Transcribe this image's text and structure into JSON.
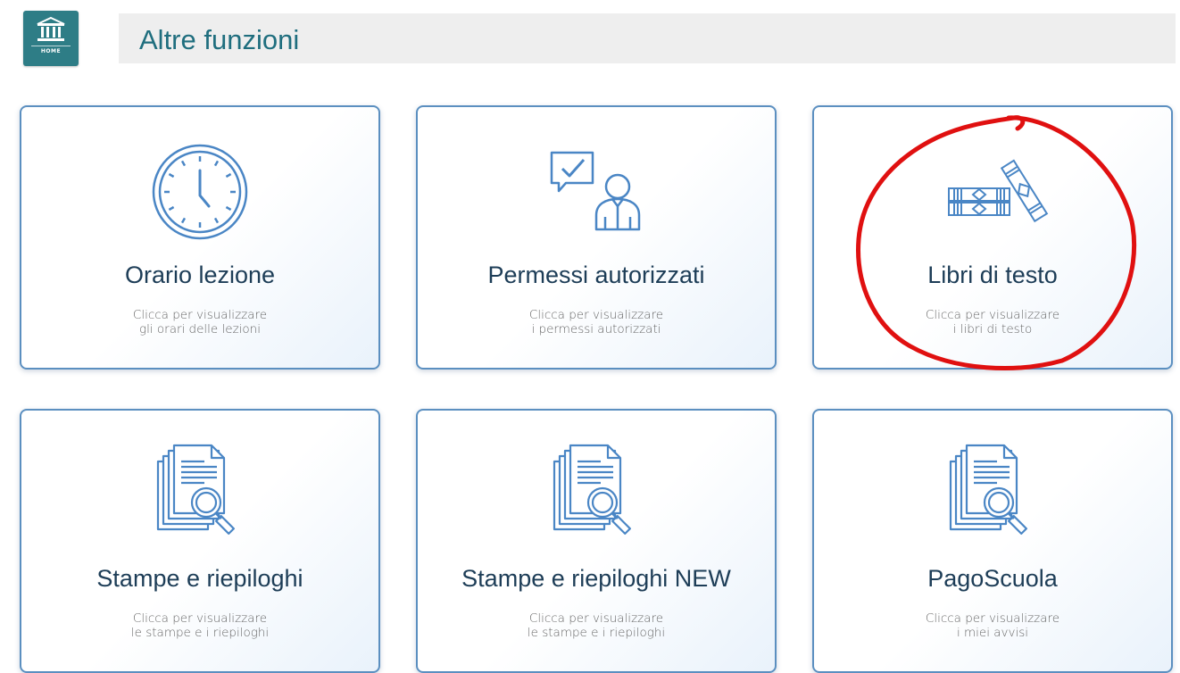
{
  "header": {
    "home_label": "HOME",
    "title": "Altre funzioni"
  },
  "cards": [
    {
      "title": "Orario lezione",
      "desc1": "Clicca per visualizzare",
      "desc2": "gli orari delle lezioni",
      "icon": "clock-icon"
    },
    {
      "title": "Permessi autorizzati",
      "desc1": "Clicca per visualizzare",
      "desc2": "i permessi autorizzati",
      "icon": "approved-person-icon"
    },
    {
      "title": "Libri di testo",
      "desc1": "Clicca per visualizzare",
      "desc2": "i libri di testo",
      "icon": "books-icon"
    },
    {
      "title": "Stampe e riepiloghi",
      "desc1": "Clicca per visualizzare",
      "desc2": "le stampe e i riepiloghi",
      "icon": "documents-search-icon"
    },
    {
      "title": "Stampe e riepiloghi NEW",
      "desc1": "Clicca per visualizzare",
      "desc2": "le stampe e i riepiloghi",
      "icon": "documents-search-icon"
    },
    {
      "title": "PagoScuola",
      "desc1": "Clicca per visualizzare",
      "desc2": "i miei avvisi",
      "icon": "documents-search-icon"
    }
  ],
  "colors": {
    "brand": "#2e7d86",
    "title": "#1f6e7e",
    "card_border": "#5b8fc0",
    "icon_stroke": "#4a86c5",
    "annotation": "#e01010"
  }
}
